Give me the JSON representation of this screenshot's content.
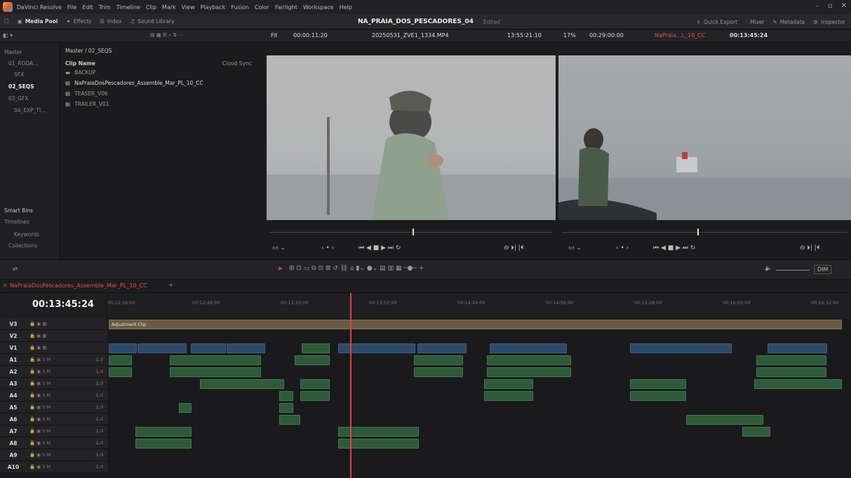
{
  "app": {
    "name": "DaVinci Resolve",
    "menu": [
      "File",
      "Edit",
      "Trim",
      "Timeline",
      "Clip",
      "Mark",
      "View",
      "Playback",
      "Fusion",
      "Color",
      "Fairlight",
      "Workspace",
      "Help"
    ]
  },
  "toolbar": {
    "media_pool": "Media Pool",
    "effects": "Effects",
    "index": "Index",
    "sound_library": "Sound Library",
    "project_name": "NA_PRAIA_DOS_PESCADORES_04",
    "edited": "Edited",
    "quick_export": "Quick Export",
    "mixer": "Mixer",
    "metadata": "Metadata",
    "inspector": "Inspector"
  },
  "media": {
    "breadcrumb": "Master / 02_SEQS",
    "col_clip": "Clip Name",
    "col_sync": "Cloud Sync",
    "tree": [
      "Master",
      "01_RODA...",
      "SFX",
      "02_SEQS",
      "03_GFX",
      "04_EXP_TI..."
    ],
    "clips": [
      "BACKUP",
      "NaPraiaDosPescadores_Assemble_Mar_PL_10_CC",
      "TEASER_V06",
      "TRAILER_V01"
    ],
    "smart_bins": "Smart Bins",
    "smart_items": [
      "Timelines",
      "Keywords",
      "Collections"
    ]
  },
  "viewer": {
    "fit": "Fit",
    "src_tc": "00:00:11:20",
    "src_clip": "20250531_ZVE1_1334.MP4",
    "src_time": "13:55:21:10",
    "zoom": "17%",
    "rec_tc": "00:29:00:00",
    "rec_name": "NaPraia...L_10_CC",
    "rec_time": "00:13:45:24"
  },
  "timeline": {
    "tab": "NaPraiaDosPescadores_Assemble_Mar_PL_10_CC",
    "timecode": "00:13:45:24",
    "ticks": [
      "00:12:16:00",
      "00:12:48:00",
      "00:13:20:00",
      "00:13:52:00",
      "00:14:24:00",
      "00:14:56:00",
      "00:15:28:00",
      "00:16:00:00",
      "00:16:32:00"
    ],
    "tracks": [
      "V3",
      "V2",
      "V1",
      "A1",
      "A2",
      "A3",
      "A4",
      "A5",
      "A6",
      "A7",
      "A8",
      "A9",
      "A10"
    ],
    "volume": "1.0",
    "adjustment": "Adjustment Clip",
    "dim": "DIM"
  },
  "colors": {
    "accent": "#e04040",
    "video": "#2e4a6b",
    "audio": "#2f5a3a",
    "adjustment": "#6b5b45"
  }
}
